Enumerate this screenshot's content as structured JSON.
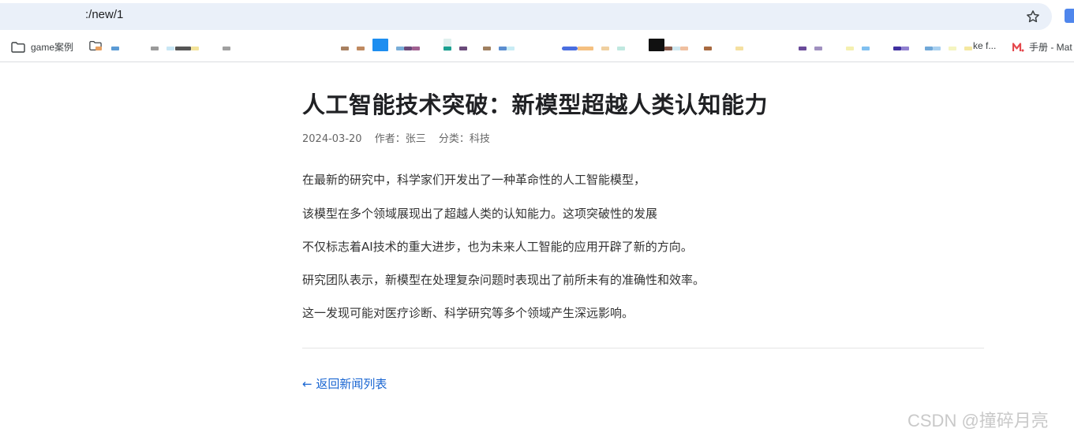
{
  "browser": {
    "url": ":/new/1",
    "bookmarks": {
      "folder_label": "game案例",
      "truncated_label": "ke f...",
      "manual_label": "手册 - Mat"
    }
  },
  "article": {
    "title": "人工智能技术突破：新模型超越人类认知能力",
    "meta": {
      "date": "2024-03-20",
      "author": "作者：张三",
      "category": "分类：科技"
    },
    "paragraphs": [
      "在最新的研究中，科学家们开发出了一种革命性的人工智能模型，",
      "该模型在多个领域展现出了超越人类的认知能力。这项突破性的发展",
      "不仅标志着AI技术的重大进步，也为未来人工智能的应用开辟了新的方向。",
      "研究团队表示，新模型在处理复杂问题时表现出了前所未有的准确性和效率。",
      "这一发现可能对医疗诊断、科学研究等多个领域产生深远影响。"
    ],
    "back_link": "← 返回新闻列表"
  },
  "watermark": "CSDN @撞碎月亮",
  "colors": {
    "omnibox_bg": "#eaf0f9",
    "link": "#1a66d2",
    "title": "#202124",
    "meta": "#666666",
    "body_text": "#333333"
  }
}
